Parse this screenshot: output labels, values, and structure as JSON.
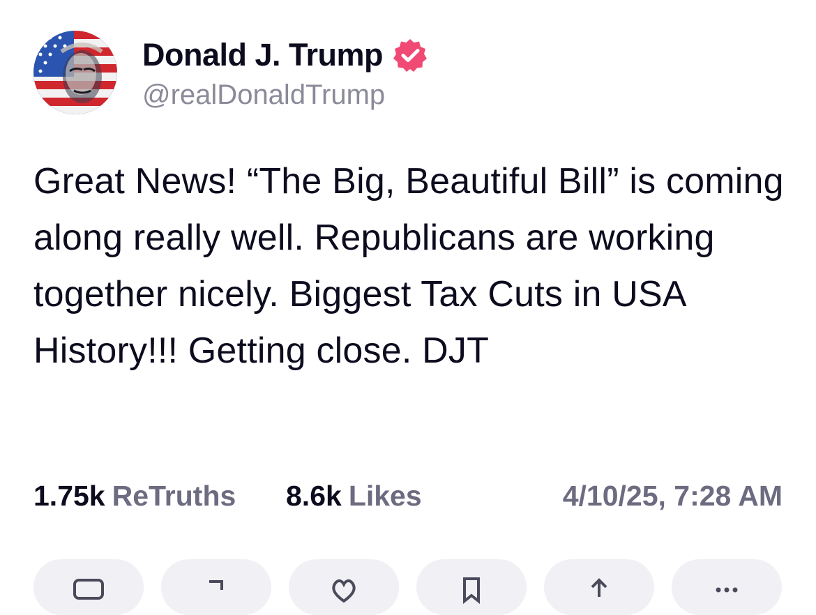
{
  "author": {
    "display_name": "Donald J. Trump",
    "handle": "@realDonaldTrump",
    "verified": true,
    "avatar_icon": "american-flag-portrait-avatar",
    "verified_icon": "verified-badge-icon",
    "verified_color": "#f04a74"
  },
  "post": {
    "text": "Great News! “The Big, Beautiful Bill” is coming along really well. Republicans are working together nicely. Biggest Tax Cuts in USA History!!! Getting close. DJT"
  },
  "stats": {
    "retruths_count": "1.75k",
    "retruths_label": "ReTruths",
    "likes_count": "8.6k",
    "likes_label": "Likes",
    "timestamp": "4/10/25, 7:28 AM"
  },
  "actions": [
    {
      "icon": "reply-icon"
    },
    {
      "icon": "retruth-icon"
    },
    {
      "icon": "like-icon"
    },
    {
      "icon": "bookmark-icon"
    },
    {
      "icon": "share-icon"
    },
    {
      "icon": "more-icon"
    }
  ],
  "colors": {
    "text_primary": "#0c0c1e",
    "text_secondary": "#6d6b80",
    "handle": "#8a8a99",
    "action_background": "#f0f0f5"
  }
}
